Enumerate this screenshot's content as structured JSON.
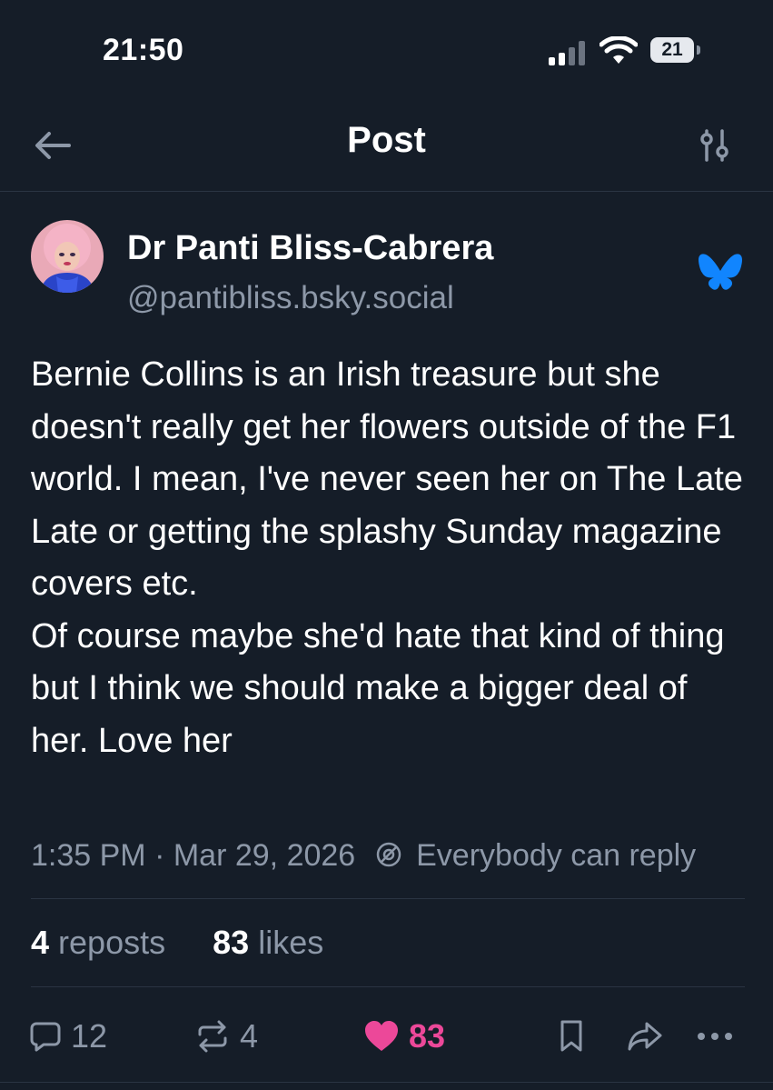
{
  "status_bar": {
    "time": "21:50",
    "battery": "21"
  },
  "header": {
    "title": "Post"
  },
  "author": {
    "name": "Dr Panti Bliss-Cabrera",
    "handle": "@pantibliss.bsky.social"
  },
  "post": {
    "paragraphs": [
      "Bernie Collins is an Irish treasure but she doesn't really get her flowers outside of the F1 world. I mean, I've never seen her on The Late Late or getting the splashy Sunday magazine covers etc.",
      "Of course maybe she'd hate that kind of thing but I think we should make a bigger deal of her. Love her"
    ],
    "time": "1:35 PM",
    "separator": "·",
    "date": "Mar 29, 2026",
    "reply_setting": "Everybody can reply"
  },
  "stats": {
    "reposts_count": "4",
    "reposts_label": "reposts",
    "likes_count": "83",
    "likes_label": "likes"
  },
  "actions": {
    "replies": "12",
    "reposts": "4",
    "likes": "83"
  },
  "colors": {
    "background": "#151d28",
    "muted_text": "#8d98a8",
    "like_pink": "#ec4899",
    "bluesky_blue": "#1185fe"
  }
}
